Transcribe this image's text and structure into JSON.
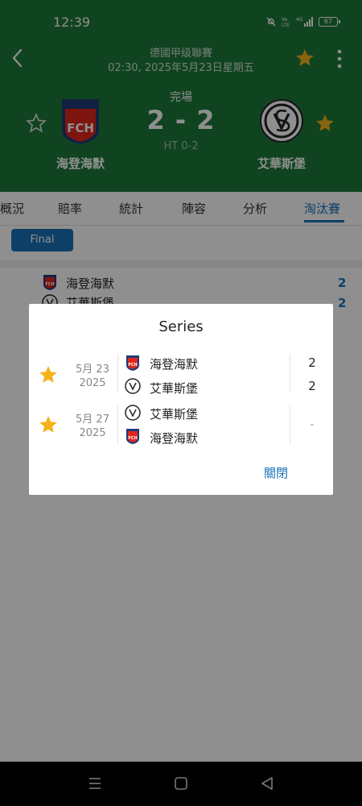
{
  "status_bar": {
    "time": "12:39",
    "battery": "67"
  },
  "header": {
    "league": "德國甲级聯賽",
    "datetime": "02:30, 2025年5月23日星期五",
    "match_status": "完場",
    "score": "2 - 2",
    "half_time": "HT 0-2",
    "home_team": "海登海默",
    "away_team": "艾華斯堡",
    "home_logo_text": "FCH"
  },
  "tabs": [
    "概況",
    "賠率",
    "統計",
    "陣容",
    "分析",
    "淘汰賽"
  ],
  "active_tab": "淘汰賽",
  "stage_chip": "Final",
  "background_list": {
    "home_team": "海登海默",
    "away_team": "艾華斯堡",
    "home_score": "2",
    "away_score": "2"
  },
  "dialog": {
    "title": "Series",
    "matches": [
      {
        "date": "5月 23",
        "year": "2025",
        "team1": "海登海默",
        "team2": "艾華斯堡",
        "score1": "2",
        "score2": "2"
      },
      {
        "date": "5月 27",
        "year": "2025",
        "team1": "艾華斯堡",
        "team2": "海登海默",
        "score": "-"
      }
    ],
    "close_label": "關閉"
  },
  "colors": {
    "header_bg": "#1e7a3a",
    "accent": "#1a72b8",
    "star": "#f5b21a"
  }
}
